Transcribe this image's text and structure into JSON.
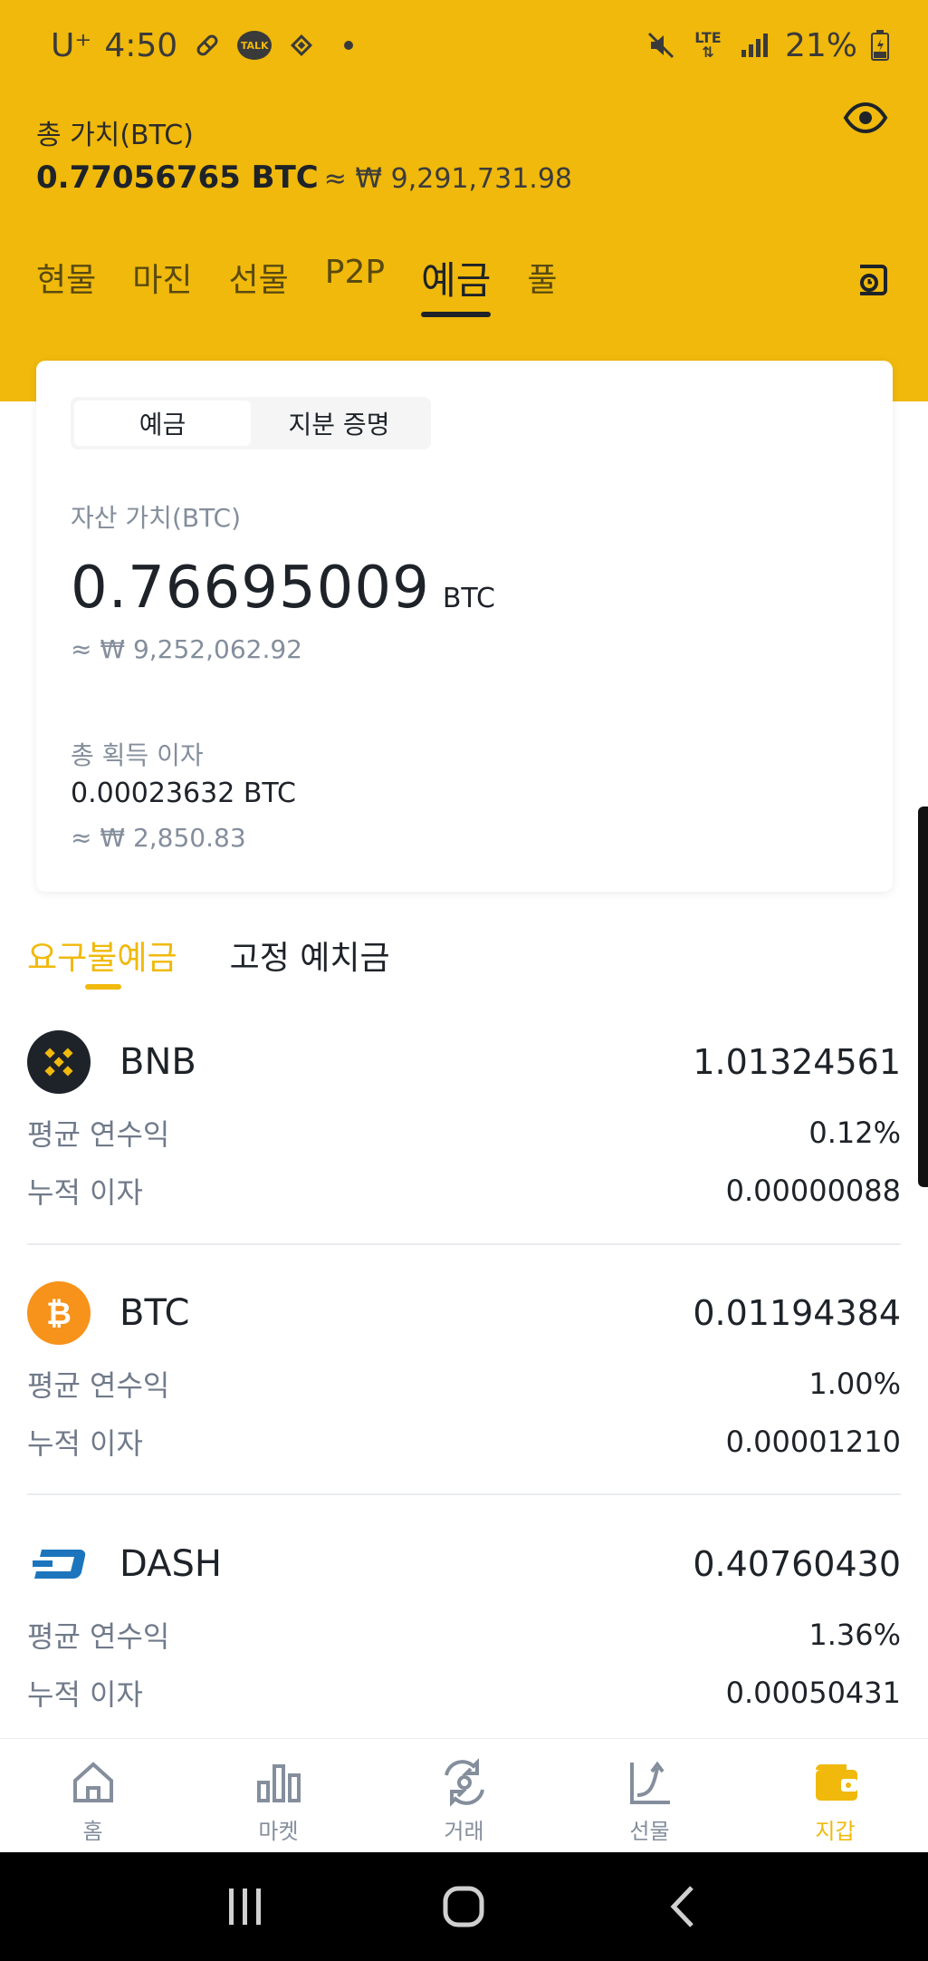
{
  "status_bar": {
    "carrier": "U⁺",
    "time": "4:50",
    "battery": "21%",
    "network": "LTE"
  },
  "header": {
    "total_label": "총 가치(BTC)",
    "total_btc": "0.77056765 BTC",
    "total_krw": "≈ ₩ 9,291,731.98",
    "tabs": [
      {
        "label": "현물"
      },
      {
        "label": "마진"
      },
      {
        "label": "선물"
      },
      {
        "label": "P2P"
      },
      {
        "label": "예금"
      },
      {
        "label": "풀"
      }
    ],
    "active_tab": "예금"
  },
  "card": {
    "segments": [
      {
        "label": "예금"
      },
      {
        "label": "지분 증명"
      }
    ],
    "asset_label": "자산 가치(BTC)",
    "asset_value": "0.76695009",
    "asset_unit": "BTC",
    "asset_krw": "≈ ₩ 9,252,062.92",
    "earn_label": "총 획득 이자",
    "earn_btc": "0.00023632 BTC",
    "earn_krw": "≈ ₩ 2,850.83"
  },
  "subtabs": [
    {
      "label": "요구불예금"
    },
    {
      "label": "고정 예치금"
    }
  ],
  "coins": [
    {
      "name": "BNB",
      "amount": "1.01324561",
      "apy_label": "평균 연수익",
      "apy": "0.12%",
      "interest_label": "누적 이자",
      "interest": "0.00000088"
    },
    {
      "name": "BTC",
      "amount": "0.01194384",
      "apy_label": "평균 연수익",
      "apy": "1.00%",
      "interest_label": "누적 이자",
      "interest": "0.00001210"
    },
    {
      "name": "DASH",
      "amount": "0.40760430",
      "apy_label": "평균 연수익",
      "apy": "1.36%",
      "interest_label": "누적 이자",
      "interest": "0.00050431"
    }
  ],
  "bottom_nav": [
    {
      "label": "홈",
      "icon": "home-icon"
    },
    {
      "label": "마켓",
      "icon": "market-icon"
    },
    {
      "label": "거래",
      "icon": "trade-icon"
    },
    {
      "label": "선물",
      "icon": "futures-icon"
    },
    {
      "label": "지갑",
      "icon": "wallet-icon"
    }
  ],
  "colors": {
    "brand": "#f0b90b",
    "text": "#1e2329",
    "muted": "#848e9c"
  }
}
